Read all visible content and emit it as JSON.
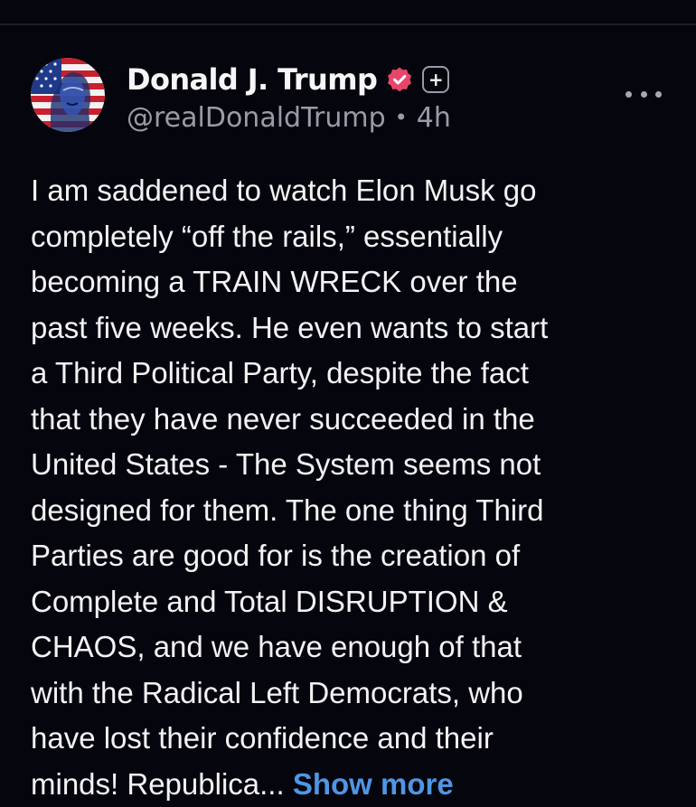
{
  "post": {
    "author": {
      "display_name": "Donald J. Trump",
      "handle": "@realDonaldTrump",
      "verified_icon": "verified-badge-icon",
      "subscription_icon": "plus-badge-icon",
      "avatar": "profile-avatar"
    },
    "separator": "•",
    "time_ago": "4h",
    "more_icon": "more-options-icon",
    "body_lines": [
      "I am saddened to watch Elon Musk go",
      "completely “off the rails,” essentially",
      "becoming a TRAIN WRECK over the",
      "past five weeks. He even wants to start",
      "a Third Political Party, despite the fact",
      "that they have never succeeded in the",
      "United States - The System seems not",
      "designed for them. The one thing Third",
      "Parties are good for is the creation of",
      "Complete and Total DISRUPTION &",
      "CHAOS, and we have enough of that",
      "with the Radical Left Democrats, who",
      "have lost their confidence and their",
      "minds! Republica..."
    ],
    "show_more_label": "Show more"
  },
  "colors": {
    "background": "#05050d",
    "text": "#f3f3f5",
    "secondary_text": "#9b9ba6",
    "link": "#4f96e3",
    "verified": "#e8456b",
    "divider": "#1e1f2a"
  }
}
